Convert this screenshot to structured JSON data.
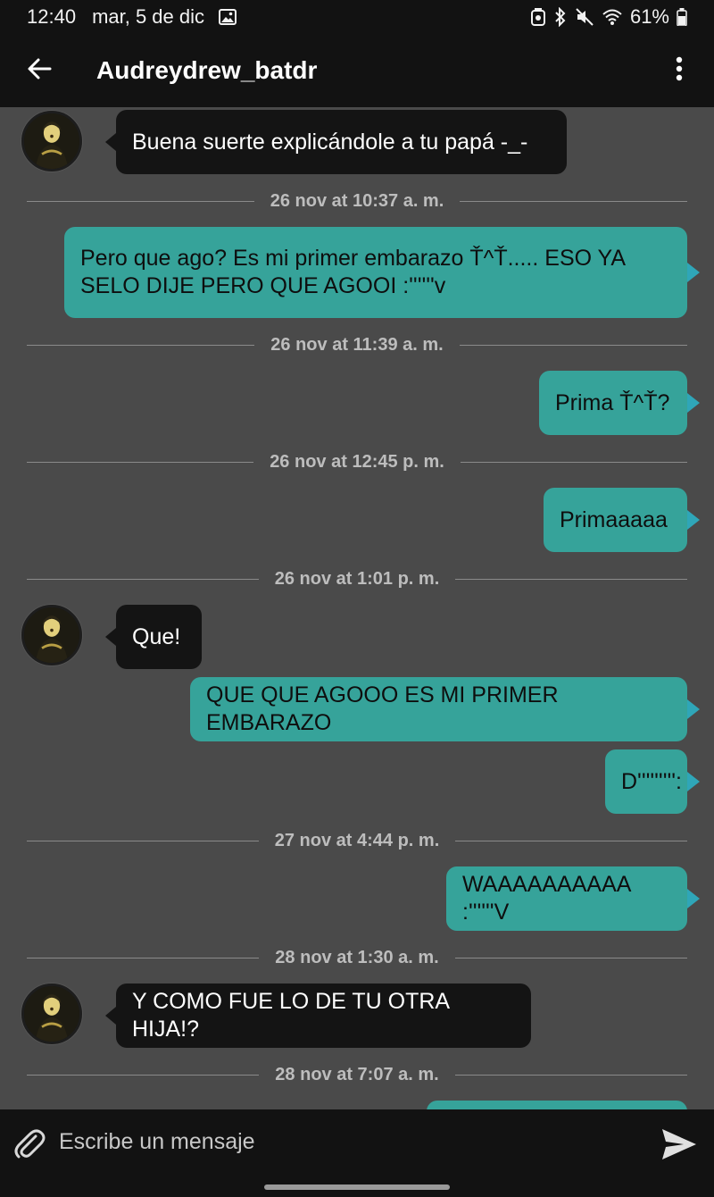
{
  "status_bar": {
    "time": "12:40",
    "date": "mar, 5 de dic",
    "battery": "61%",
    "icons": [
      "image-icon",
      "screenshot-icon",
      "bluetooth-icon",
      "mute-icon",
      "wifi-icon",
      "battery-icon"
    ]
  },
  "header": {
    "title": "Audreydrew_batdr",
    "back_icon": "arrow-left-icon",
    "menu_icon": "more-vert-icon"
  },
  "messages": [
    {
      "type": "in",
      "text": "Buena suerte explicándole a tu papá -_-"
    },
    {
      "type": "divider",
      "text": "26 nov at 10:37 a. m."
    },
    {
      "type": "out",
      "text": "Pero que ago? Es mi primer embarazo Ť^Ť..... ESO YA SELO DIJE PERO QUE AGOOI :''''''v"
    },
    {
      "type": "divider",
      "text": "26 nov at 11:39 a. m."
    },
    {
      "type": "out",
      "text": "Prima Ť^Ť?"
    },
    {
      "type": "divider",
      "text": "26 nov at 12:45 p. m."
    },
    {
      "type": "out",
      "text": "Primaaaaa"
    },
    {
      "type": "divider",
      "text": "26 nov at 1:01 p. m."
    },
    {
      "type": "in",
      "text": "Que!"
    },
    {
      "type": "out",
      "text": "QUE QUE AGOOO ES MI PRIMER EMBARAZO"
    },
    {
      "type": "out",
      "text": "D''''''''':"
    },
    {
      "type": "divider",
      "text": "27 nov at 4:44 p. m."
    },
    {
      "type": "out",
      "text": "WAAAAAAAAAA :''''''V"
    },
    {
      "type": "divider",
      "text": "28 nov at 1:30 a. m."
    },
    {
      "type": "in",
      "text": "Y COMO FUE LO DE TU OTRA HIJA!?"
    },
    {
      "type": "divider",
      "text": "28 nov at 7:07 a. m."
    }
  ],
  "input": {
    "placeholder": "Escribe un mensaje",
    "attach_icon": "paperclip-icon",
    "send_icon": "send-icon"
  },
  "colors": {
    "background": "#4a4a4a",
    "bar": "#121212",
    "incoming_bubble": "#141414",
    "outgoing_bubble": "#36a39a",
    "outgoing_tail": "#2fa6b8"
  }
}
